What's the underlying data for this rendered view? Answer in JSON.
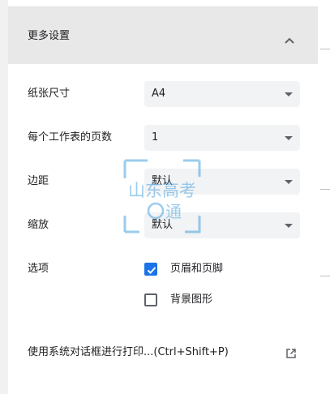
{
  "section": {
    "title": "更多设置"
  },
  "settings": {
    "paper_size": {
      "label": "纸张尺寸",
      "value": "A4"
    },
    "pages_per_sheet": {
      "label": "每个工作表的页数",
      "value": "1"
    },
    "margins": {
      "label": "边距",
      "value": "默认"
    },
    "scale": {
      "label": "缩放",
      "value": "默认"
    },
    "options": {
      "label": "选项",
      "items": [
        {
          "label": "页眉和页脚",
          "checked": true
        },
        {
          "label": "背景图形",
          "checked": false
        }
      ]
    }
  },
  "system_dialog": {
    "label": "使用系统对话框进行打印...(Ctrl+Shift+P)"
  },
  "watermark": {
    "text_line1": "山东高考",
    "text_line2": "通"
  },
  "colors": {
    "accent": "#1a73e8",
    "header_bg": "#e8e8e8",
    "select_bg": "#f1f3f4",
    "watermark": "#4aa3df"
  },
  "icons": {
    "collapse": "chevron-up-icon",
    "dropdown": "dropdown-arrow-icon",
    "open_external": "open-in-new-icon",
    "check": "check-icon"
  }
}
